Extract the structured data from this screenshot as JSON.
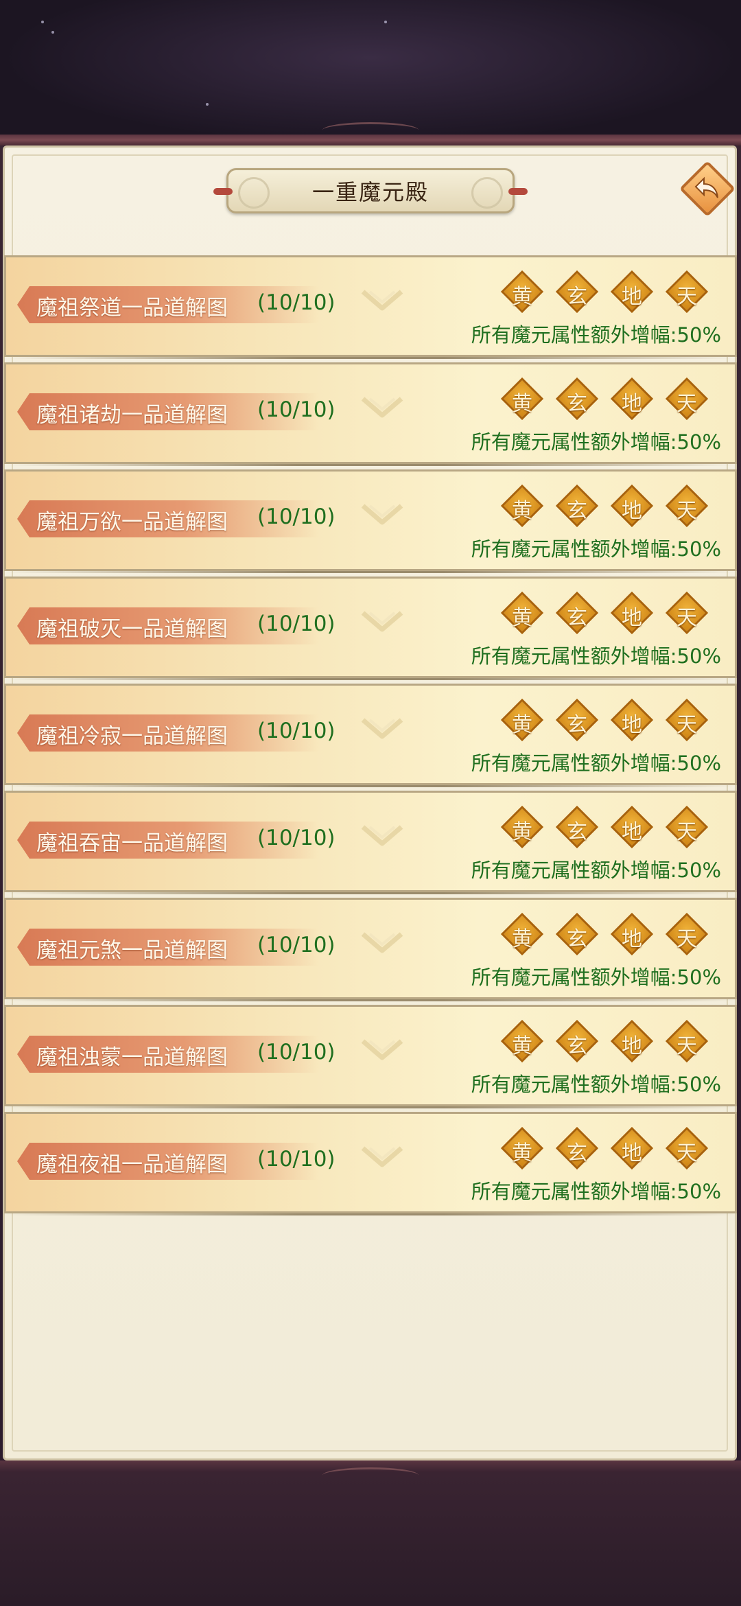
{
  "header": {
    "title": "一重魔元殿"
  },
  "rows": [
    {
      "name": "魔祖祭道一品道解图",
      "progress": "(10/10)",
      "badges": [
        "黄",
        "玄",
        "地",
        "天"
      ],
      "bonus": "所有魔元属性额外增幅:50%"
    },
    {
      "name": "魔祖诸劫一品道解图",
      "progress": "(10/10)",
      "badges": [
        "黄",
        "玄",
        "地",
        "天"
      ],
      "bonus": "所有魔元属性额外增幅:50%"
    },
    {
      "name": "魔祖万欲一品道解图",
      "progress": "(10/10)",
      "badges": [
        "黄",
        "玄",
        "地",
        "天"
      ],
      "bonus": "所有魔元属性额外增幅:50%"
    },
    {
      "name": "魔祖破灭一品道解图",
      "progress": "(10/10)",
      "badges": [
        "黄",
        "玄",
        "地",
        "天"
      ],
      "bonus": "所有魔元属性额外增幅:50%"
    },
    {
      "name": "魔祖冷寂一品道解图",
      "progress": "(10/10)",
      "badges": [
        "黄",
        "玄",
        "地",
        "天"
      ],
      "bonus": "所有魔元属性额外增幅:50%"
    },
    {
      "name": "魔祖吞宙一品道解图",
      "progress": "(10/10)",
      "badges": [
        "黄",
        "玄",
        "地",
        "天"
      ],
      "bonus": "所有魔元属性额外增幅:50%"
    },
    {
      "name": "魔祖元煞一品道解图",
      "progress": "(10/10)",
      "badges": [
        "黄",
        "玄",
        "地",
        "天"
      ],
      "bonus": "所有魔元属性额外增幅:50%"
    },
    {
      "name": "魔祖浊蒙一品道解图",
      "progress": "(10/10)",
      "badges": [
        "黄",
        "玄",
        "地",
        "天"
      ],
      "bonus": "所有魔元属性额外增幅:50%"
    },
    {
      "name": "魔祖夜祖一品道解图",
      "progress": "(10/10)",
      "badges": [
        "黄",
        "玄",
        "地",
        "天"
      ],
      "bonus": "所有魔元属性额外增幅:50%"
    }
  ],
  "icons": {
    "back": "back-arrow-icon",
    "expand": "chevron-down-icon"
  },
  "colors": {
    "progress_green": "#1f6f1f",
    "badge_gold": "#cf8414",
    "ribbon": "#d87a55"
  }
}
